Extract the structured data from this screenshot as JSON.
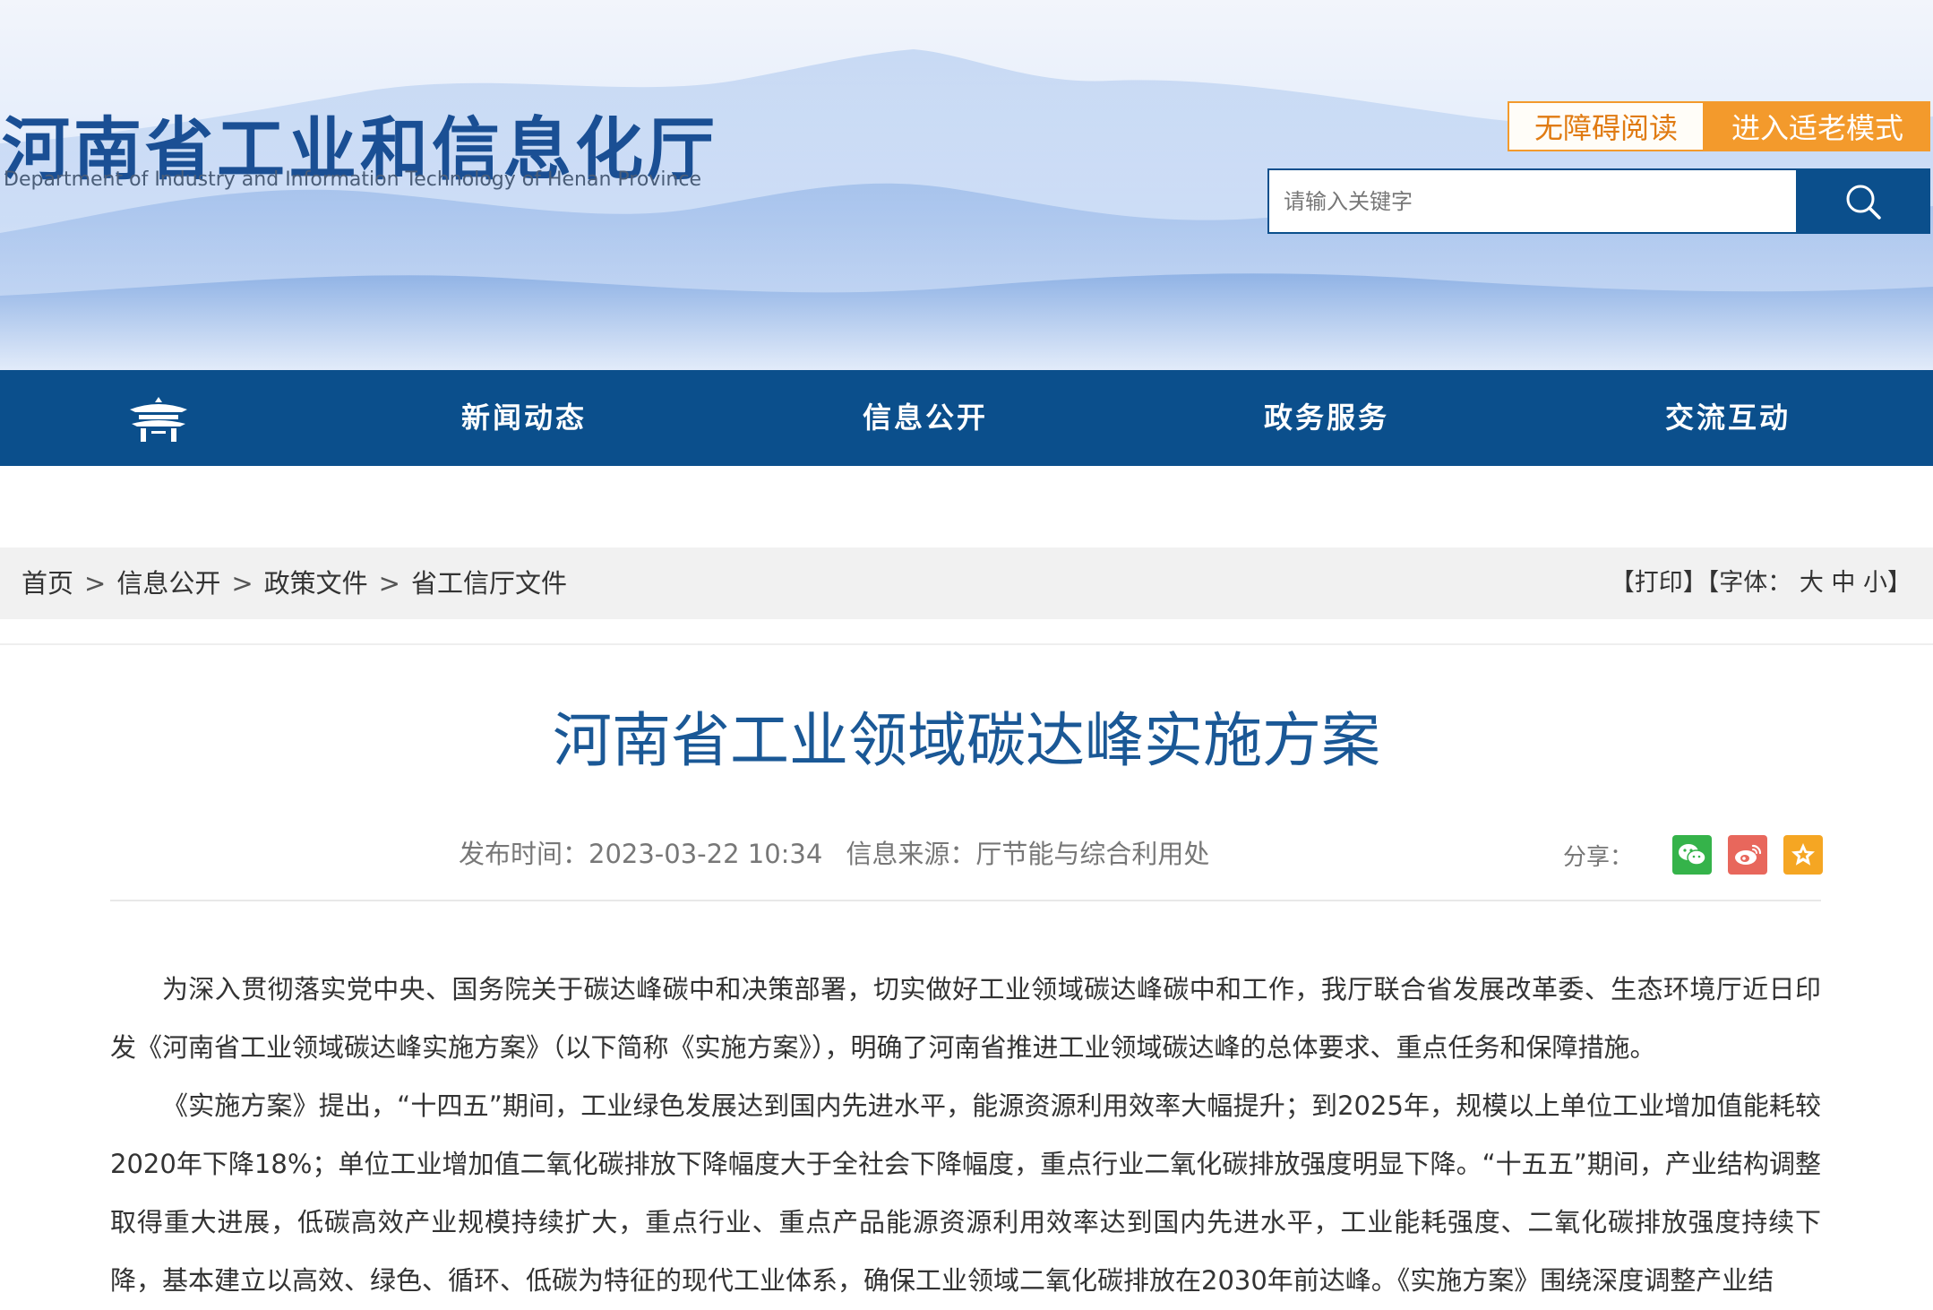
{
  "header": {
    "logo_cn": "河南省工业和信息化厅",
    "logo_en": "Department of Industry and Information Technology of Henan Province",
    "accessibility_label": "无障碍阅读",
    "elder_mode_label": "进入适老模式",
    "search_placeholder": "请输入关键字",
    "search_icon": "search-icon"
  },
  "nav": {
    "home_icon": "pavilion-home-icon",
    "items": [
      "新闻动态",
      "信息公开",
      "政务服务",
      "交流互动"
    ]
  },
  "breadcrumb": {
    "items": [
      "首页",
      "信息公开",
      "政策文件",
      "省工信厅文件"
    ],
    "separator": ">"
  },
  "tools": {
    "print": "【打印】",
    "font_size_label": "【字体：",
    "font_large": "大",
    "font_medium": "中",
    "font_small": "小",
    "font_close": "】"
  },
  "article": {
    "title": "河南省工业领域碳达峰实施方案",
    "publish_time": "发布时间：2023-03-22 10:34",
    "source": "信息来源：厅节能与综合利用处",
    "share_label": "分享：",
    "share_icons": [
      "wechat-icon",
      "weibo-icon",
      "favorite-star-icon"
    ],
    "paragraphs": [
      "为深入贯彻落实党中央、国务院关于碳达峰碳中和决策部署，切实做好工业领域碳达峰碳中和工作，我厅联合省发展改革委、生态环境厅近日印发《河南省工业领域碳达峰实施方案》（以下简称《实施方案》），明确了河南省推进工业领域碳达峰的总体要求、重点任务和保障措施。",
      "《实施方案》提出，“十四五”期间，工业绿色发展达到国内先进水平，能源资源利用效率大幅提升；到2025年，规模以上单位工业增加值能耗较2020年下降18%；单位工业增加值二氧化碳排放下降幅度大于全社会下降幅度，重点行业二氧化碳排放强度明显下降。“十五五”期间，产业结构调整取得重大进展，低碳高效产业规模持续扩大，重点行业、重点产品能源资源利用效率达到国内先进水平，工业能耗强度、二氧化碳排放强度持续下降，基本建立以高效、绿色、循环、低碳为特征的现代工业体系，确保工业领域二氧化碳排放在2030年前达峰。《实施方案》围绕深度调整产业结"
    ]
  },
  "colors": {
    "primary_blue": "#0b4f8c",
    "title_blue": "#1a5896",
    "orange": "#f39a2c",
    "wechat_green": "#35b34a",
    "weibo_red": "#e8675c",
    "star_orange": "#f5a623"
  }
}
